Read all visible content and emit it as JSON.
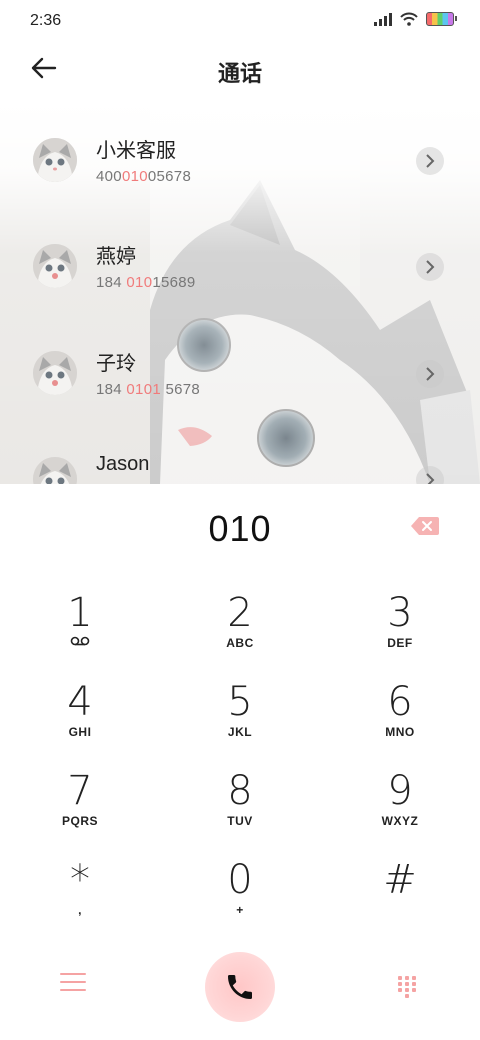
{
  "status": {
    "time": "2:36"
  },
  "header": {
    "title": "通话"
  },
  "contacts": [
    {
      "name": "小米客服",
      "number_pre": "400",
      "number_hl": "010",
      "number_post": "05678"
    },
    {
      "name": "燕婷",
      "number_pre": "184 ",
      "number_hl": "010",
      "number_post": "15689"
    },
    {
      "name": "子玲",
      "number_pre": "184 ",
      "number_hl": "0101",
      "number_post": " 5678"
    },
    {
      "name": "Jason",
      "number_pre": "",
      "number_hl": "",
      "number_post": ""
    }
  ],
  "dialer": {
    "number": "010"
  },
  "keypad": [
    {
      "digit": "1",
      "letters": ""
    },
    {
      "digit": "2",
      "letters": "ABC"
    },
    {
      "digit": "3",
      "letters": "DEF"
    },
    {
      "digit": "4",
      "letters": "GHI"
    },
    {
      "digit": "5",
      "letters": "JKL"
    },
    {
      "digit": "6",
      "letters": "MNO"
    },
    {
      "digit": "7",
      "letters": "PQRS"
    },
    {
      "digit": "8",
      "letters": "TUV"
    },
    {
      "digit": "9",
      "letters": "WXYZ"
    },
    {
      "digit": "*",
      "letters": ","
    },
    {
      "digit": "0",
      "letters": "+"
    },
    {
      "digit": "#",
      "letters": ""
    }
  ],
  "colors": {
    "accent": "#f07b7b",
    "call_button": "#ffc9c9"
  }
}
